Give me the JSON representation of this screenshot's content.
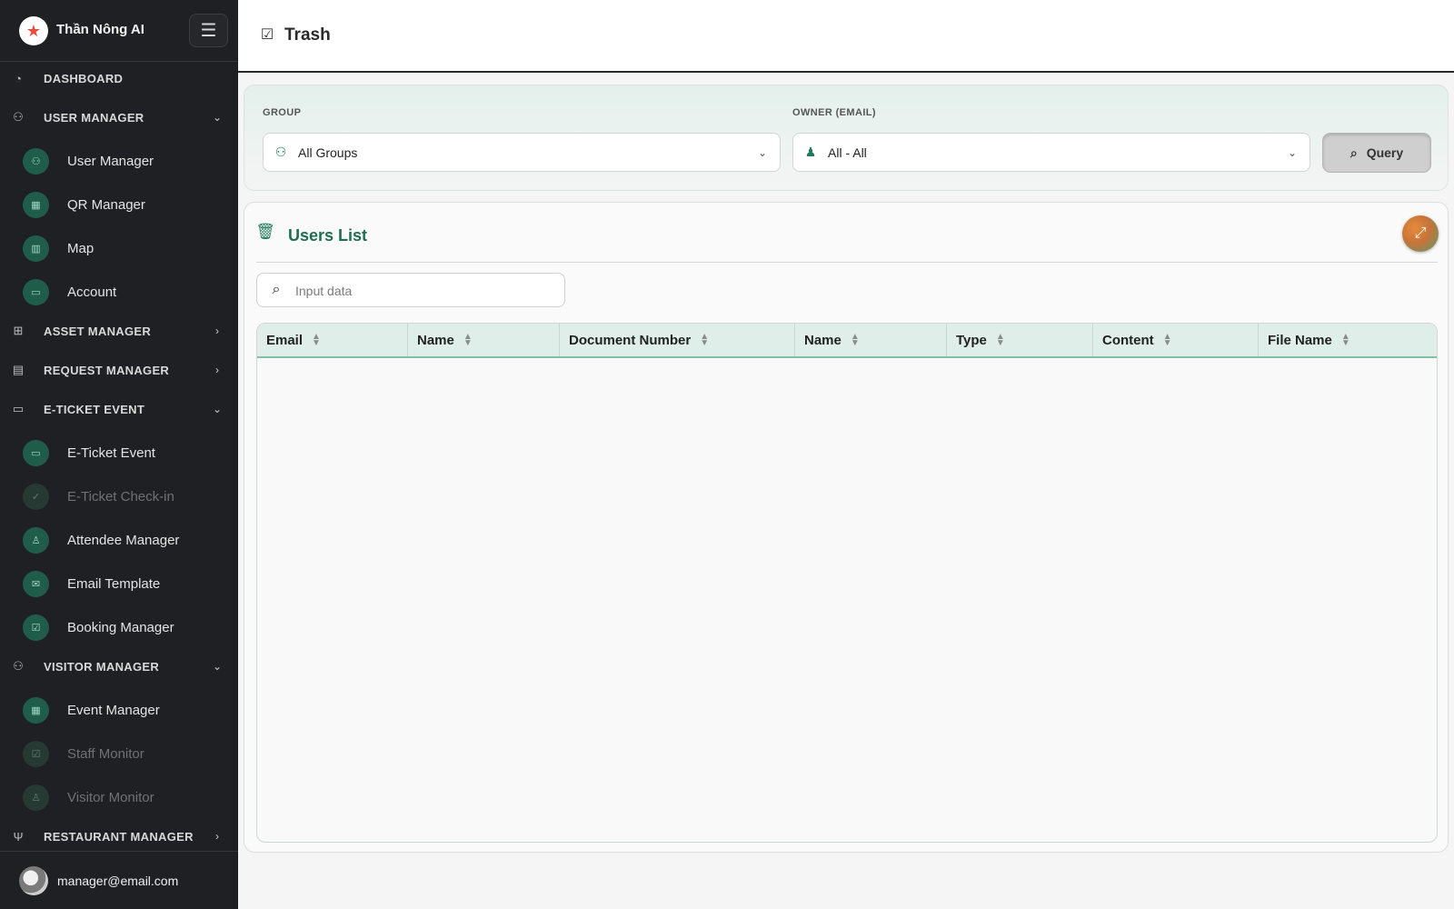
{
  "brand": {
    "name": "Thần Nông AI",
    "logo_icon": "star-logo-icon",
    "menu_icon": "hamburger-icon"
  },
  "sidebar": {
    "sections": [
      {
        "label": "DASHBOARD",
        "icon": "dashboard-icon",
        "chevron": ""
      },
      {
        "label": "USER MANAGER",
        "icon": "users-icon",
        "chevron": "down"
      },
      {
        "label": "ASSET MANAGER",
        "icon": "sitemap-icon",
        "chevron": "right"
      },
      {
        "label": "REQUEST MANAGER",
        "icon": "clipboard-icon",
        "chevron": "right"
      },
      {
        "label": "E-TICKET EVENT",
        "icon": "ticket-icon",
        "chevron": "down"
      },
      {
        "label": "VISITOR MANAGER",
        "icon": "visitors-icon",
        "chevron": "down"
      },
      {
        "label": "RESTAURANT MANAGER",
        "icon": "utensils-icon",
        "chevron": "right"
      }
    ],
    "items": [
      {
        "label": "User Manager",
        "icon": "users-icon",
        "disabled": false
      },
      {
        "label": "QR Manager",
        "icon": "qr-icon",
        "disabled": false
      },
      {
        "label": "Map",
        "icon": "map-icon",
        "disabled": false
      },
      {
        "label": "Account",
        "icon": "id-card-icon",
        "disabled": false
      },
      {
        "label": "E-Ticket Event",
        "icon": "ticket-icon",
        "disabled": false
      },
      {
        "label": "E-Ticket Check-in",
        "icon": "user-check-icon",
        "disabled": true
      },
      {
        "label": "Attendee Manager",
        "icon": "user-icon",
        "disabled": false
      },
      {
        "label": "Email Template",
        "icon": "envelope-icon",
        "disabled": false
      },
      {
        "label": "Booking Manager",
        "icon": "calendar-check-icon",
        "disabled": false
      },
      {
        "label": "Event Manager",
        "icon": "calendar-icon",
        "disabled": false
      },
      {
        "label": "Staff Monitor",
        "icon": "clipboard-check-icon",
        "disabled": true
      },
      {
        "label": "Visitor Monitor",
        "icon": "visitor-icon",
        "disabled": true
      }
    ]
  },
  "user": {
    "email": "manager@email.com"
  },
  "header": {
    "title": "Trash",
    "icon": "clipboard-check-icon"
  },
  "filters": {
    "group_label": "GROUP",
    "group_value": "All Groups",
    "owner_label": "OWNER (EMAIL)",
    "owner_value": "All - All",
    "query_label": "Query"
  },
  "list": {
    "title": "Users List",
    "search_placeholder": "Input data",
    "columns": [
      "Email",
      "Name",
      "Document Number",
      "Name",
      "Type",
      "Content",
      "File Name"
    ],
    "rows": []
  },
  "colors": {
    "accent": "#1f7a5a",
    "sidebar_bg": "#1f2023",
    "header_row": "#dfeee8"
  }
}
